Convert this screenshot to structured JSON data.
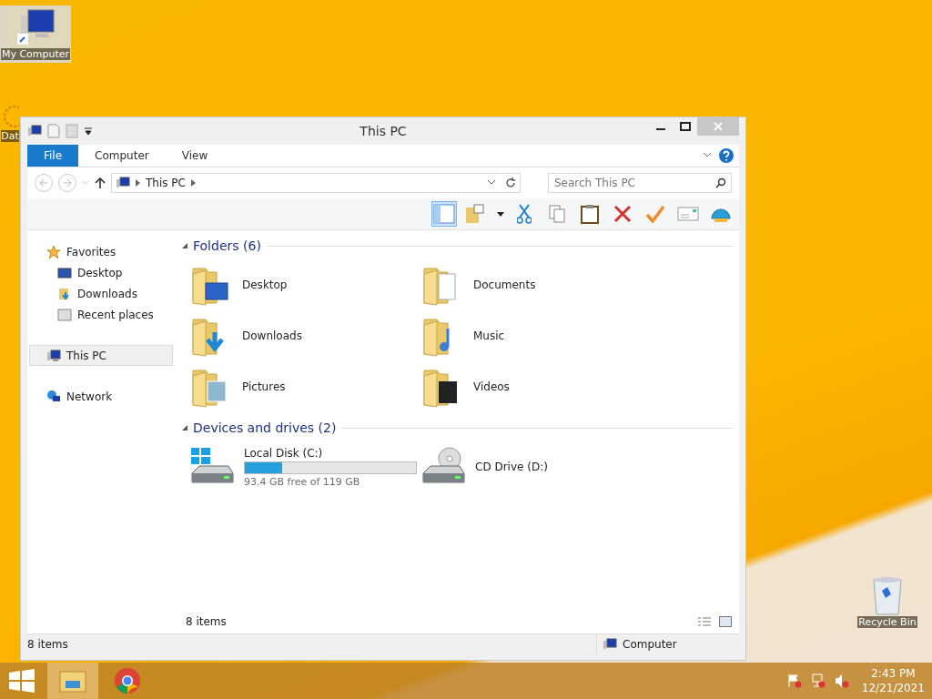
{
  "desktop_icons": [
    {
      "label": "My Computer",
      "kind": "computer",
      "selected": true
    },
    {
      "label": "Dat",
      "kind": "gear",
      "selected": false
    },
    {
      "label": "Recycle Bin",
      "kind": "bin",
      "selected": false
    }
  ],
  "window": {
    "title": "This PC",
    "ribbon_tabs": [
      {
        "label": "File",
        "selected": true
      },
      {
        "label": "Computer",
        "selected": false
      },
      {
        "label": "View",
        "selected": false
      }
    ],
    "address": {
      "path": "This PC"
    },
    "search": {
      "placeholder": "Search This PC"
    },
    "sidebar": {
      "items": [
        {
          "label": "Favorites",
          "kind": "star",
          "selected": false,
          "children": [
            {
              "label": "Desktop",
              "kind": "desktop",
              "selected": false
            },
            {
              "label": "Downloads",
              "kind": "downloads",
              "selected": false
            },
            {
              "label": "Recent places",
              "kind": "recent",
              "selected": false
            }
          ]
        },
        {
          "label": "This PC",
          "kind": "pc",
          "selected": true
        },
        {
          "label": "Network",
          "kind": "network",
          "selected": false
        }
      ]
    },
    "sections": [
      {
        "heading": "Folders (6)",
        "items": [
          {
            "label": "Desktop",
            "kind": "desktop"
          },
          {
            "label": "Documents",
            "kind": "documents"
          },
          {
            "label": "Downloads",
            "kind": "downloads"
          },
          {
            "label": "Music",
            "kind": "music"
          },
          {
            "label": "Pictures",
            "kind": "pictures"
          },
          {
            "label": "Videos",
            "kind": "videos"
          }
        ]
      },
      {
        "heading": "Devices and drives (2)",
        "items": [
          {
            "label": "Local Disk (C:)",
            "kind": "disk",
            "level": 0.22,
            "reading": "93.4 GB free of 119 GB"
          },
          {
            "label": "CD Drive (D:)",
            "kind": "cd"
          }
        ]
      }
    ],
    "content_footer": "8 items",
    "status_bar": {
      "count": "8 items",
      "location": "Computer"
    }
  },
  "taskbar": {
    "time": "2:43 PM",
    "date": "12/21/2021"
  }
}
